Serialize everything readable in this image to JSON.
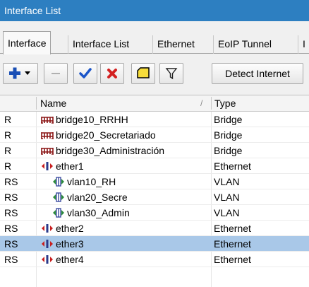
{
  "window": {
    "title": "Interface List"
  },
  "tabs": [
    "Interface",
    "Interface List",
    "Ethernet",
    "EoIP Tunnel",
    "I"
  ],
  "toolbar": {
    "detect_label": "Detect Internet",
    "colors": {
      "add": "#1a4fb5",
      "enable": "#1b55c9",
      "disable": "#d32020",
      "comment": "#f6dc3a"
    }
  },
  "table": {
    "columns": {
      "flags": "",
      "name": "Name",
      "type": "Type"
    },
    "sort_indicator": "/",
    "rows": [
      {
        "flags": "R",
        "name": "bridge10_RRHH",
        "type": "Bridge",
        "icon": "bridge-icon",
        "indent": 0,
        "selected": false
      },
      {
        "flags": "R",
        "name": "bridge20_Secretariado",
        "type": "Bridge",
        "icon": "bridge-icon",
        "indent": 0,
        "selected": false
      },
      {
        "flags": "R",
        "name": "bridge30_Administración",
        "type": "Bridge",
        "icon": "bridge-icon",
        "indent": 0,
        "selected": false
      },
      {
        "flags": "R",
        "name": "ether1",
        "type": "Ethernet",
        "icon": "ethernet-icon",
        "indent": 0,
        "selected": false
      },
      {
        "flags": "RS",
        "name": "vlan10_RH",
        "type": "VLAN",
        "icon": "vlan-icon",
        "indent": 1,
        "selected": false
      },
      {
        "flags": "RS",
        "name": "vlan20_Secre",
        "type": "VLAN",
        "icon": "vlan-icon",
        "indent": 1,
        "selected": false
      },
      {
        "flags": "RS",
        "name": "vlan30_Admin",
        "type": "VLAN",
        "icon": "vlan-icon",
        "indent": 1,
        "selected": false
      },
      {
        "flags": "RS",
        "name": "ether2",
        "type": "Ethernet",
        "icon": "ethernet-icon",
        "indent": 0,
        "selected": false
      },
      {
        "flags": "RS",
        "name": "ether3",
        "type": "Ethernet",
        "icon": "ethernet-icon",
        "indent": 0,
        "selected": true
      },
      {
        "flags": "RS",
        "name": "ether4",
        "type": "Ethernet",
        "icon": "ethernet-icon",
        "indent": 0,
        "selected": false
      }
    ]
  }
}
